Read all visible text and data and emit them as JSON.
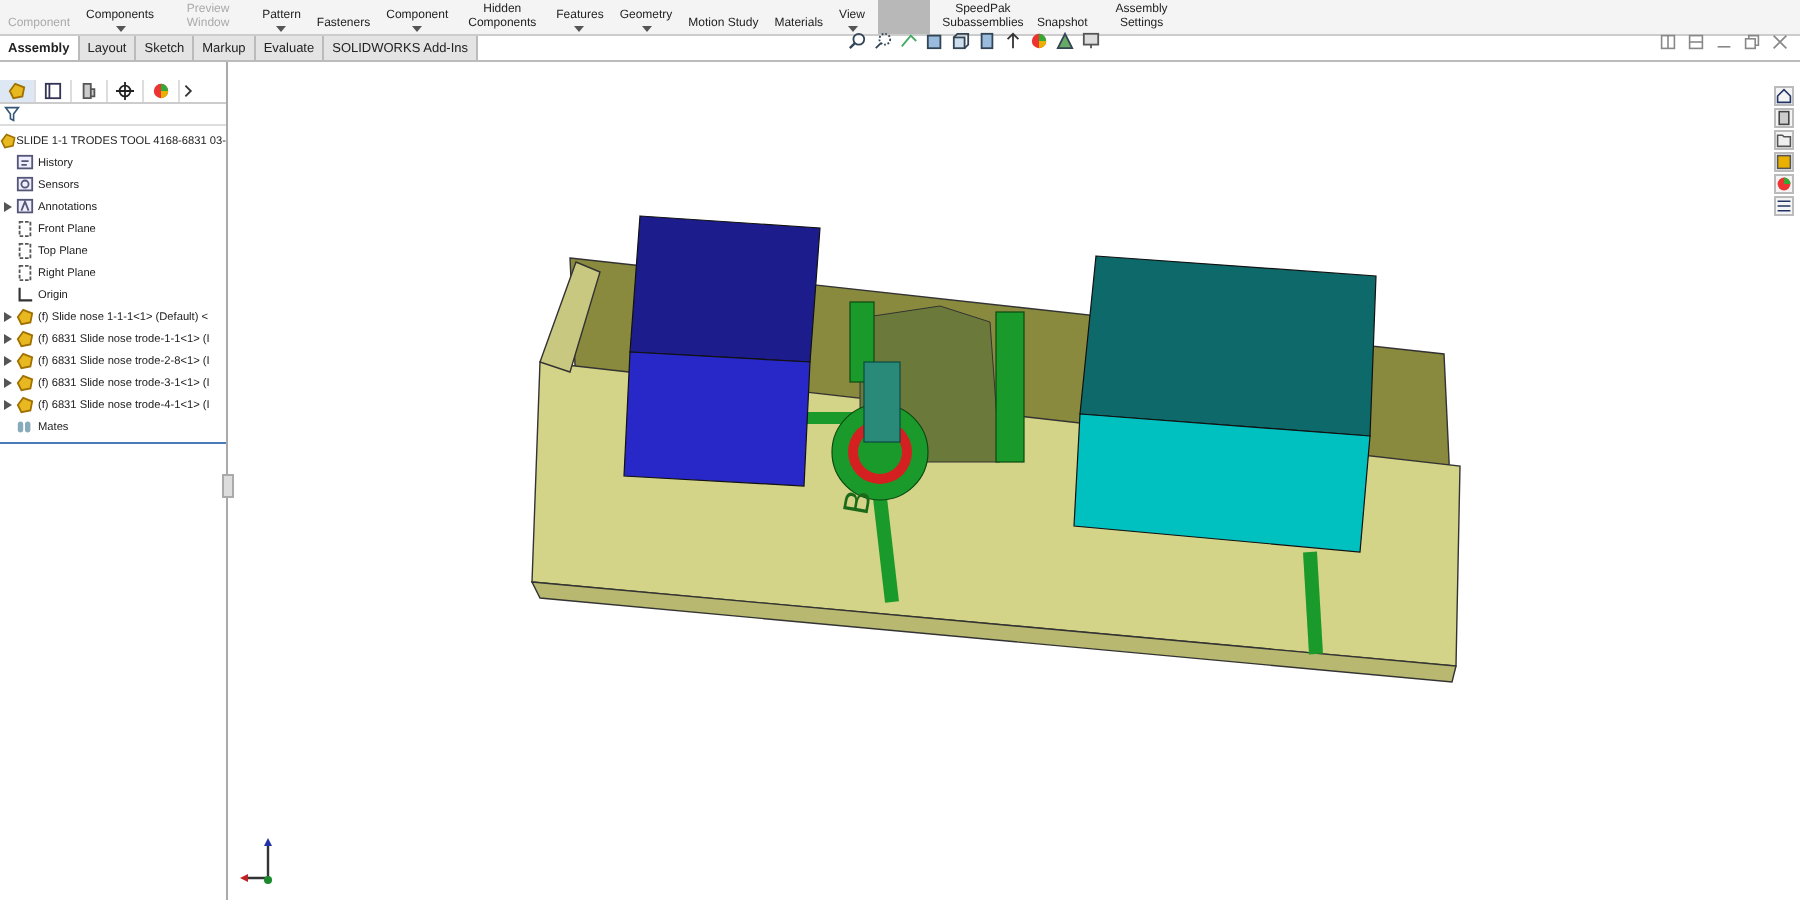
{
  "ribbon": {
    "items": [
      {
        "label": "Component",
        "disabled": true,
        "dropdown": false
      },
      {
        "label": "Components",
        "disabled": false,
        "dropdown": true
      },
      {
        "label": "Preview Window",
        "disabled": true,
        "dropdown": false
      },
      {
        "label": "Pattern",
        "disabled": false,
        "dropdown": true
      },
      {
        "label": "Fasteners",
        "disabled": false,
        "dropdown": false
      },
      {
        "label": "Component",
        "disabled": false,
        "dropdown": true
      },
      {
        "label": "Hidden Components",
        "disabled": false,
        "dropdown": false
      },
      {
        "label": "Features",
        "disabled": false,
        "dropdown": true
      },
      {
        "label": "Geometry",
        "disabled": false,
        "dropdown": true
      },
      {
        "label": "Motion Study",
        "disabled": false,
        "dropdown": false
      },
      {
        "label": "Materials",
        "disabled": false,
        "dropdown": false
      },
      {
        "label": "View",
        "disabled": false,
        "dropdown": true
      }
    ],
    "right_items": [
      {
        "label": "SpeedPak Subassemblies",
        "disabled": false,
        "dropdown": false
      },
      {
        "label": "Snapshot",
        "disabled": false,
        "dropdown": false
      },
      {
        "label": "Assembly Settings",
        "disabled": false,
        "dropdown": false
      }
    ]
  },
  "tabs": [
    {
      "label": "Assembly",
      "selected": true
    },
    {
      "label": "Layout",
      "selected": false
    },
    {
      "label": "Sketch",
      "selected": false
    },
    {
      "label": "Markup",
      "selected": false
    },
    {
      "label": "Evaluate",
      "selected": false
    },
    {
      "label": "SOLIDWORKS Add-Ins",
      "selected": false
    }
  ],
  "feature_tree": {
    "root": "SLIDE 1-1 TRODES TOOL 4168-6831 03-",
    "items": [
      {
        "label": "History",
        "kind": "history",
        "expandable": false
      },
      {
        "label": "Sensors",
        "kind": "sensor",
        "expandable": false
      },
      {
        "label": "Annotations",
        "kind": "annotation",
        "expandable": true
      },
      {
        "label": "Front Plane",
        "kind": "plane",
        "expandable": false
      },
      {
        "label": "Top Plane",
        "kind": "plane",
        "expandable": false
      },
      {
        "label": "Right Plane",
        "kind": "plane",
        "expandable": false
      },
      {
        "label": "Origin",
        "kind": "origin",
        "expandable": false
      },
      {
        "label": "(f) Slide nose 1-1-1<1> (Default) <",
        "kind": "part",
        "expandable": true
      },
      {
        "label": "(f) 6831 Slide nose trode-1-1<1> (I",
        "kind": "part",
        "expandable": true
      },
      {
        "label": "(f) 6831 Slide nose trode-2-8<1> (I",
        "kind": "part",
        "expandable": true
      },
      {
        "label": "(f) 6831 Slide nose trode-3-1<1> (I",
        "kind": "part",
        "expandable": true
      },
      {
        "label": "(f) 6831 Slide nose trode-4-1<1> (I",
        "kind": "part",
        "expandable": true
      },
      {
        "label": "Mates",
        "kind": "mates",
        "expandable": false
      }
    ]
  },
  "model": {
    "engraved_label": "B"
  }
}
